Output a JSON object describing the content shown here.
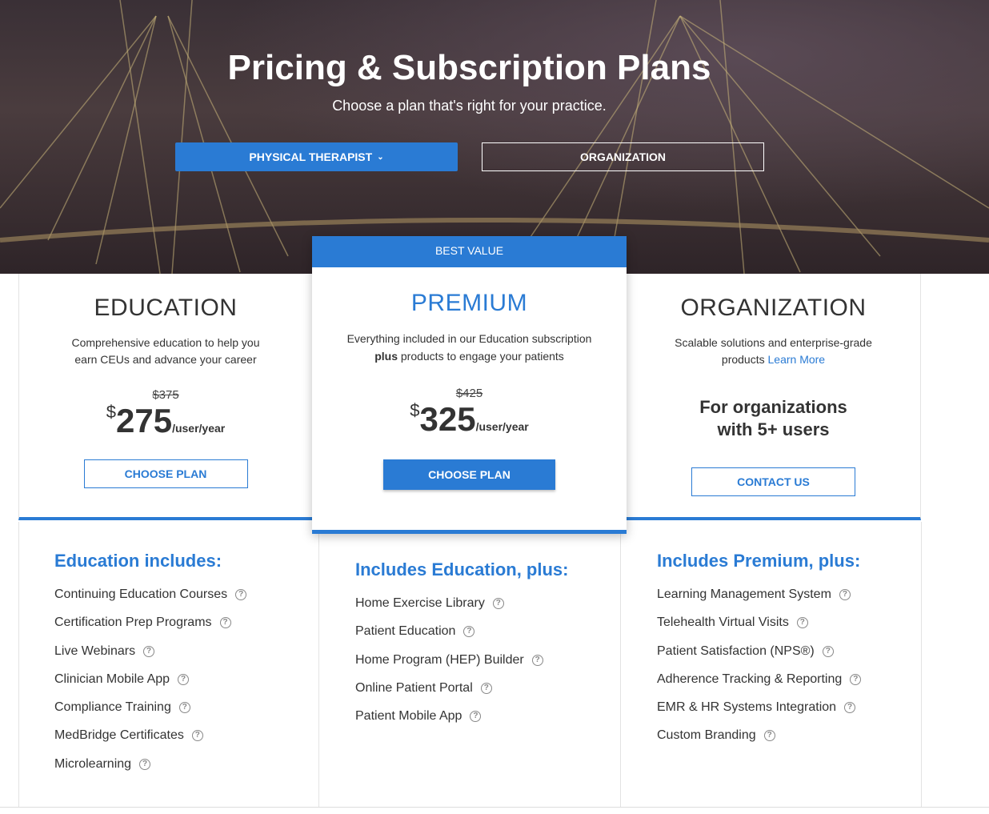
{
  "hero": {
    "title": "Pricing & Subscription Plans",
    "subtitle": "Choose a plan that's right for your practice.",
    "tabs": [
      {
        "label": "PHYSICAL THERAPIST",
        "active": true
      },
      {
        "label": "ORGANIZATION",
        "active": false
      }
    ]
  },
  "accent": "#2a7bd4",
  "plans": [
    {
      "name": "EDUCATION",
      "desc1": "Comprehensive education to help you",
      "desc2": "earn CEUs and advance your career",
      "old_price": "$375",
      "currency": "$",
      "price": "275",
      "unit": "/user/year",
      "button": "CHOOSE PLAN"
    },
    {
      "badge": "BEST VALUE",
      "name": "PREMIUM",
      "desc1": "Everything included in our Education subscription",
      "desc2_bold": "plus",
      "desc2": " products to engage your patients",
      "old_price": "$425",
      "currency": "$",
      "price": "325",
      "unit": "/user/year",
      "button": "CHOOSE PLAN"
    },
    {
      "name": "ORGANIZATION",
      "desc1": "Scalable solutions and enterprise-grade",
      "desc2": "products ",
      "link": "Learn More",
      "headline1": "For organizations",
      "headline2": "with 5+ users",
      "button": "CONTACT US"
    }
  ],
  "features": [
    {
      "heading": "Education includes:",
      "items": [
        "Continuing Education Courses",
        "Certification Prep Programs",
        "Live Webinars",
        "Clinician Mobile App",
        "Compliance Training",
        "MedBridge Certificates",
        "Microlearning"
      ]
    },
    {
      "heading": "Includes Education, plus:",
      "items": [
        "Home Exercise Library",
        "Patient Education",
        "Home Program (HEP) Builder",
        "Online Patient Portal",
        "Patient Mobile App"
      ]
    },
    {
      "heading": "Includes Premium, plus:",
      "items": [
        "Learning Management System",
        "Telehealth Virtual Visits",
        "Patient Satisfaction (NPS®)",
        "Adherence Tracking & Reporting",
        "EMR & HR Systems Integration",
        "Custom Branding"
      ]
    }
  ]
}
